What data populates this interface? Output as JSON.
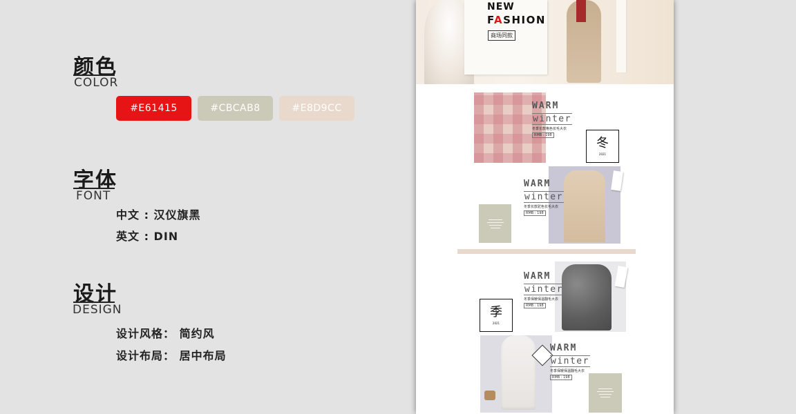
{
  "colors": {
    "title": "颜色",
    "subtitle": "COLOR",
    "swatches": [
      {
        "label": "#E61415",
        "hex": "#e61415"
      },
      {
        "label": "#CBCAB8",
        "hex": "#cbcab8"
      },
      {
        "label": "#E8D9CC",
        "hex": "#e8d9cc"
      }
    ]
  },
  "font": {
    "title": "字体",
    "subtitle": "FONT",
    "chinese": "中文 : 汉仪旗黑",
    "english": "英文 : DIN"
  },
  "design": {
    "title": "设计",
    "subtitle": "DESIGN",
    "style": "设计风格：  简约风",
    "layout": "设计布局：  居中布局"
  },
  "preview": {
    "banner": {
      "new": "NEW",
      "fashion_f": "F",
      "fashion_a": "A",
      "fashion_rest": "SHION",
      "tag": "商场同款"
    },
    "products": [
      {
        "warm": "WARM",
        "winter": "winter",
        "desc": "冬季长款格色长毛大衣",
        "price": "RMB : 198"
      },
      {
        "warm": "WARM",
        "winter": "winter",
        "desc": "冬季长款驼色长毛大衣",
        "price": "RMB : 198"
      },
      {
        "warm": "WARM",
        "winter": "winter",
        "desc": "冬季保暖保温翻毛大衣",
        "price": "RMB : 198"
      },
      {
        "warm": "WARM",
        "winter": "winter",
        "desc": "冬季保暖保温翻毛大衣",
        "price": "RMB : 198"
      }
    ],
    "seals": [
      {
        "char": "冬",
        "year": "2021"
      },
      {
        "char": "季",
        "year": "2021"
      }
    ]
  }
}
